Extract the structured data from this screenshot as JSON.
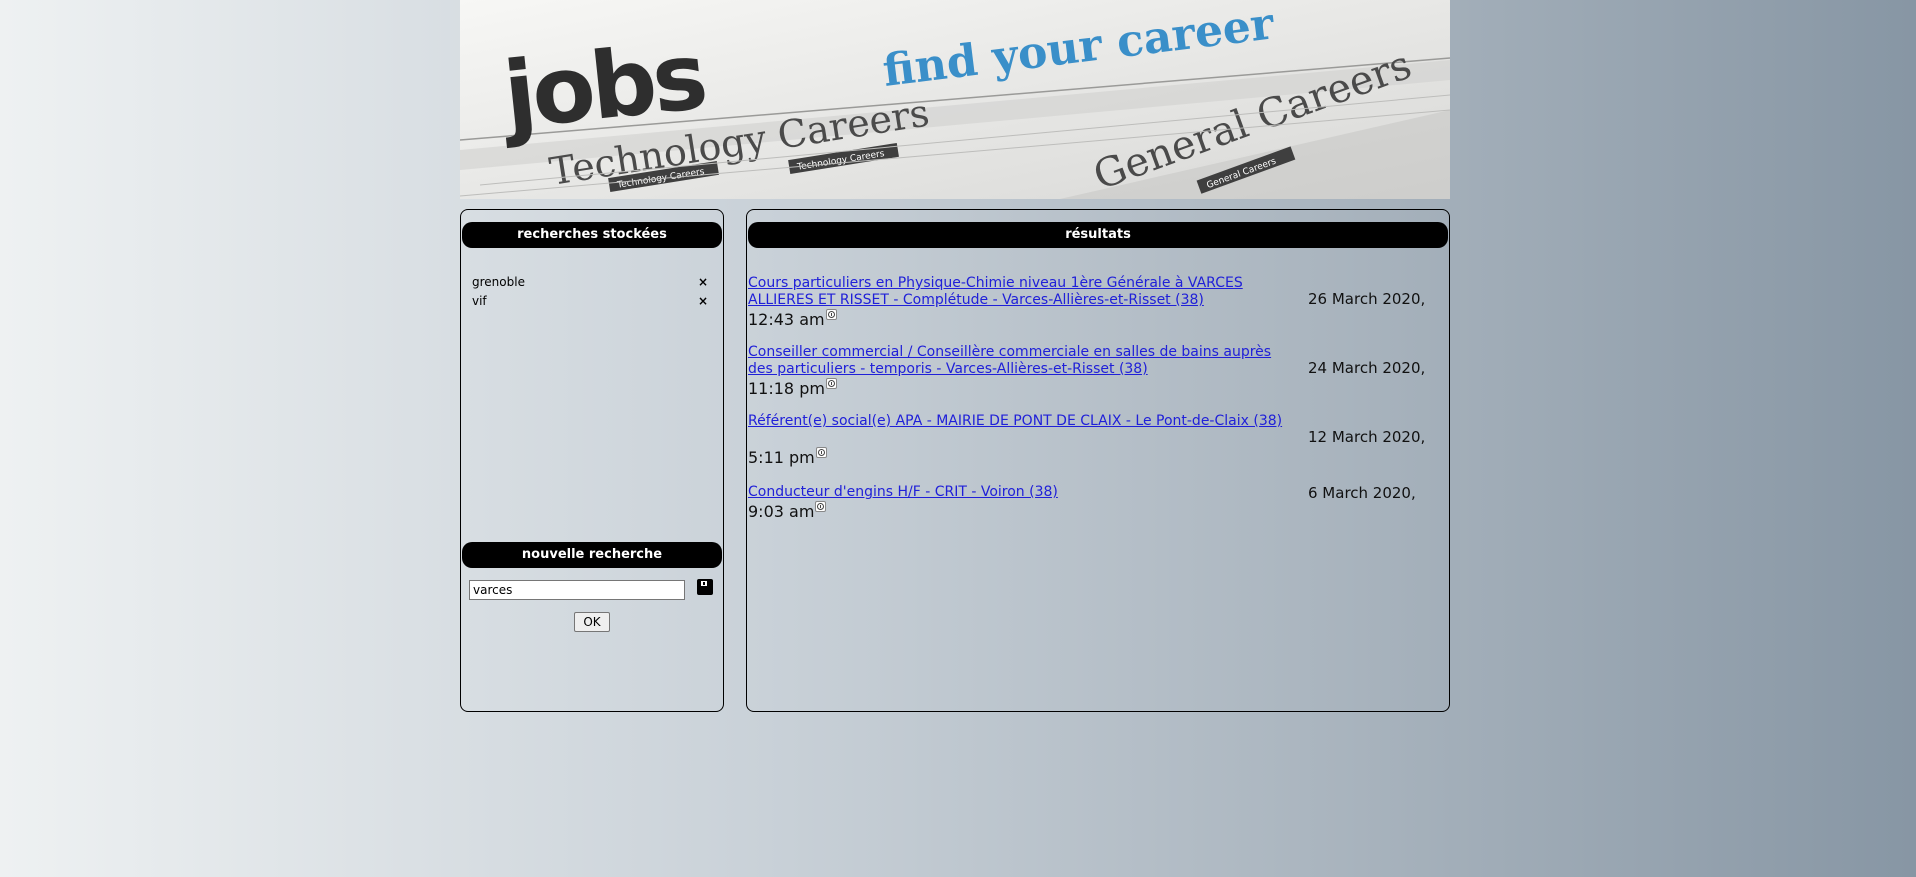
{
  "banner": {
    "word_jobs": "jobs",
    "tagline": "find your career",
    "section_left": "Technology Careers",
    "section_right": "General Careers",
    "tab_1": "Technology Careers",
    "tab_2": "Technology Careers",
    "tab_3": "General Careers",
    "accent_color": "#3a8fc9"
  },
  "saved_searches": {
    "header": "recherches stockées",
    "items": [
      {
        "label": "grenoble",
        "delete_icon": "×"
      },
      {
        "label": "vif",
        "delete_icon": "×"
      }
    ]
  },
  "new_search": {
    "header": "nouvelle recherche",
    "input_value": "varces",
    "save_icon": "floppy-disk-icon",
    "ok_label": "OK"
  },
  "results": {
    "header": "résultats",
    "link_color": "#2020d8",
    "items": [
      {
        "title": "Cours particuliers en Physique-Chimie niveau 1ère Générale à VARCES ALLIERES ET RISSET - Complétude - Varces-Allières-et-Risset (38)",
        "date": "26 March 2020,",
        "time": "12:43 am"
      },
      {
        "title": "Conseiller commercial / Conseillère commerciale en salles de bains auprès des particuliers - temporis - Varces-Allières-et-Risset (38)",
        "date": "24 March 2020,",
        "time": "11:18 pm"
      },
      {
        "title": "Référent(e) social(e) APA - MAIRIE DE PONT DE CLAIX - Le Pont-de-Claix (38)",
        "date": "12 March 2020,",
        "time": "5:11 pm"
      },
      {
        "title": "Conducteur d'engins H/F - CRIT - Voiron (38)",
        "date": "6 March 2020,",
        "time": "9:03 am"
      }
    ]
  }
}
